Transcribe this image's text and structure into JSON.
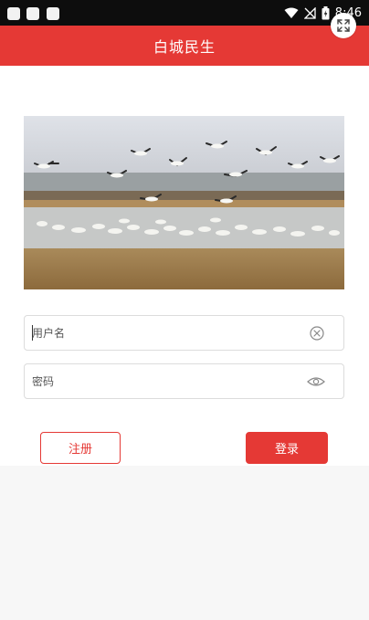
{
  "status_bar": {
    "time": "8:46"
  },
  "app_bar": {
    "title": "白城民生"
  },
  "banner": {
    "description": ""
  },
  "form": {
    "username": {
      "placeholder": "用户名",
      "value": ""
    },
    "password": {
      "placeholder": "密码",
      "value": ""
    }
  },
  "buttons": {
    "register_label": "注册",
    "login_label": "登录"
  },
  "colors": {
    "brand_red": "#e53935",
    "status_bar": "#0d0d0d",
    "background": "#f7f7f7"
  },
  "icons": {
    "expand": "expand-arrows-icon",
    "clear": "clear-circle-icon",
    "visibility": "eye-icon",
    "wifi": "wifi-icon",
    "signal": "signal-icon",
    "battery": "battery-icon"
  }
}
